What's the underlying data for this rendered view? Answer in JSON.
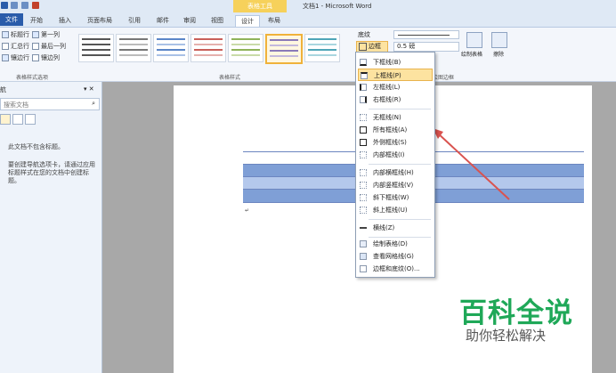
{
  "window": {
    "title": "文档1 - Microsoft Word",
    "context_tab_title": "表格工具"
  },
  "tabs": [
    {
      "label": "文件"
    },
    {
      "label": "开始"
    },
    {
      "label": "插入"
    },
    {
      "label": "页面布局"
    },
    {
      "label": "引用"
    },
    {
      "label": "邮件"
    },
    {
      "label": "审阅"
    },
    {
      "label": "视图"
    },
    {
      "label": "设计"
    },
    {
      "label": "布局"
    }
  ],
  "style_options": {
    "items": [
      {
        "label": "标题行",
        "checked": true
      },
      {
        "label": "第一列",
        "checked": true
      },
      {
        "label": "汇总行",
        "checked": false
      },
      {
        "label": "最后一列",
        "checked": false
      },
      {
        "label": "镶边行",
        "checked": true
      },
      {
        "label": "镶边列",
        "checked": false
      }
    ],
    "group_label": "表格样式选项"
  },
  "table_styles": {
    "group_label": "表格样式"
  },
  "borders_group": {
    "shading_label": "底纹",
    "borders_label": "边框",
    "pen_weight": "0.5 磅",
    "draw_table_label": "绘制表格",
    "eraser_label": "擦除",
    "group_label": "绘图边框"
  },
  "nav_pane": {
    "title": "航",
    "search_placeholder": "搜索文档",
    "no_headings": "此文档不包含标题。",
    "hint": "要创建导航选项卡，请通过应用标题样式在您的文档中创建标题。"
  },
  "border_menu": {
    "items": [
      {
        "label": "下框线(B)"
      },
      {
        "label": "上框线(P)"
      },
      {
        "label": "左框线(L)"
      },
      {
        "label": "右框线(R)"
      },
      {
        "label": "无框线(N)"
      },
      {
        "label": "所有框线(A)"
      },
      {
        "label": "外侧框线(S)"
      },
      {
        "label": "内部框线(I)"
      },
      {
        "label": "内部横框线(H)"
      },
      {
        "label": "内部竖框线(V)"
      },
      {
        "label": "斜下框线(W)"
      },
      {
        "label": "斜上框线(U)"
      },
      {
        "label": "横线(Z)"
      },
      {
        "label": "绘制表格(D)"
      },
      {
        "label": "查看网格线(G)"
      },
      {
        "label": "边框和底纹(O)..."
      }
    ],
    "highlighted_index": 1
  },
  "watermark": {
    "title": "百科全说",
    "subtitle": "助你轻松解决"
  },
  "colors": {
    "accent": "#2a5caa",
    "row_dark": "#7f9fd6",
    "row_light": "#b4c8ec",
    "highlight": "#fde3a0",
    "arrow": "#d9534f"
  }
}
